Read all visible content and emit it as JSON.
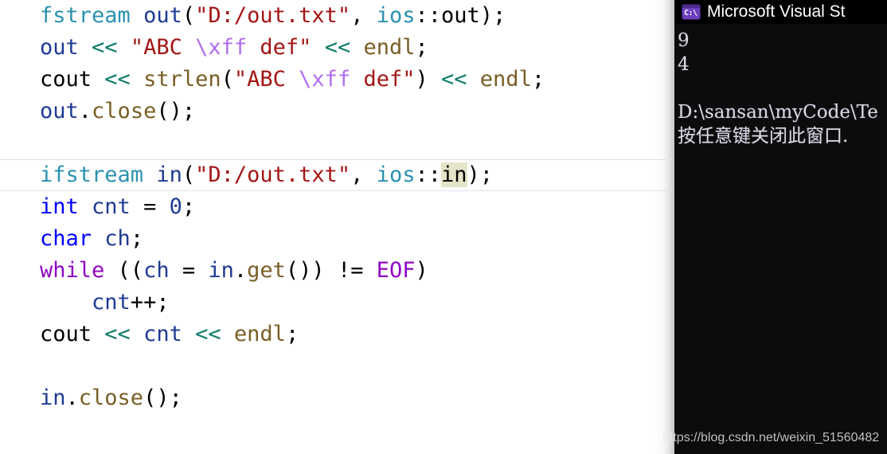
{
  "editor": {
    "name": "code-editor",
    "language": "cpp",
    "current_line_index": 5,
    "highlighted_reference": "in",
    "lines": [
      {
        "id": "line-1",
        "text": "fstream out(\"D:/out.txt\", ios::out);"
      },
      {
        "id": "line-2",
        "text": "out << \"ABC \\xff def\" << endl;"
      },
      {
        "id": "line-3",
        "text": "cout << strlen(\"ABC \\xff def\") << endl;"
      },
      {
        "id": "line-4",
        "text": "out.close();"
      },
      {
        "id": "line-5",
        "text": ""
      },
      {
        "id": "line-6",
        "text": "ifstream in(\"D:/out.txt\", ios::in);"
      },
      {
        "id": "line-7",
        "text": "int cnt = 0;"
      },
      {
        "id": "line-8",
        "text": "char ch;"
      },
      {
        "id": "line-9",
        "text": "while ((ch = in.get()) != EOF)"
      },
      {
        "id": "line-10",
        "text": "    cnt++;"
      },
      {
        "id": "line-11",
        "text": "cout << cnt << endl;"
      },
      {
        "id": "line-12",
        "text": ""
      },
      {
        "id": "line-13",
        "text": "in.close();"
      }
    ],
    "tokens": {
      "line1": [
        "fstream",
        "out",
        "(",
        "\"D:/out.txt\"",
        ",",
        "ios",
        "::",
        "out",
        ")",
        ";"
      ],
      "line2": [
        "out",
        "<<",
        "\"ABC ",
        "\\xff",
        " def\"",
        "<<",
        "endl",
        ";"
      ],
      "line3": [
        "cout",
        "<<",
        "strlen",
        "(",
        "\"ABC ",
        "\\xff",
        " def\"",
        ")",
        "<<",
        "endl",
        ";"
      ],
      "line4": [
        "out",
        ".",
        "close",
        "(",
        ")",
        ";"
      ],
      "line6": [
        "ifstream",
        "in",
        "(",
        "\"D:/out.txt\"",
        ",",
        "ios",
        "::",
        "in",
        ")",
        ";"
      ],
      "line7": [
        "int",
        "cnt",
        "=",
        "0",
        ";"
      ],
      "line8": [
        "char",
        "ch",
        ";"
      ],
      "line9": [
        "while",
        "(",
        "(",
        "ch",
        "=",
        "in",
        ".",
        "get",
        "(",
        ")",
        ")",
        "!=",
        "EOF",
        ")"
      ],
      "line10": [
        "cnt",
        "++",
        ";"
      ],
      "line11": [
        "cout",
        "<<",
        "cnt",
        "<<",
        "endl",
        ";"
      ],
      "line13": [
        "in",
        ".",
        "close",
        "(",
        ")",
        ";"
      ]
    }
  },
  "code_text": {
    "l1_type": "fstream",
    "l1_sp1": " ",
    "l1_var": "out",
    "l1_paren_open": "(",
    "l1_str": "\"D:/out.txt\"",
    "l1_comma": ", ",
    "l1_ios": "ios",
    "l1_scope": "::out",
    "l1_tail": ");",
    "l2_var": "out",
    "l2_sp1": " ",
    "l2_op1": "<<",
    "l2_sp2": " ",
    "l2_str_a": "\"ABC ",
    "l2_esc": "\\xff",
    "l2_str_b": " def\"",
    "l2_sp3": " ",
    "l2_op2": "<<",
    "l2_sp4": " ",
    "l2_endl": "endl",
    "l2_semi": ";",
    "l3_cout": "cout",
    "l3_sp1": " ",
    "l3_op1": "<<",
    "l3_sp2": " ",
    "l3_fn": "strlen",
    "l3_paren_open": "(",
    "l3_str_a": "\"ABC ",
    "l3_esc": "\\xff",
    "l3_str_b": " def\"",
    "l3_paren_close": ")",
    "l3_sp3": " ",
    "l3_op2": "<<",
    "l3_sp4": " ",
    "l3_endl": "endl",
    "l3_semi": ";",
    "l4_var": "out",
    "l4_dot": ".",
    "l4_fn": "close",
    "l4_tail": "();",
    "l6_type": "ifstream",
    "l6_sp1": " ",
    "l6_var": "in",
    "l6_paren_open": "(",
    "l6_str": "\"D:/out.txt\"",
    "l6_comma": ", ",
    "l6_ios": "ios",
    "l6_scope": "::",
    "l6_hl": "in",
    "l6_tail": ");",
    "l7_kw": "int",
    "l7_sp1": " ",
    "l7_var": "cnt",
    "l7_eq": " = ",
    "l7_num": "0",
    "l7_semi": ";",
    "l8_kw": "char",
    "l8_sp1": " ",
    "l8_var": "ch",
    "l8_semi": ";",
    "l9_kw": "while",
    "l9_sp1": " ",
    "l9_p1": "((",
    "l9_ch": "ch",
    "l9_eq": " = ",
    "l9_in": "in",
    "l9_dot": ".",
    "l9_get": "get",
    "l9_p2": "())",
    "l9_sp2": " ",
    "l9_neq": "!=",
    "l9_sp3": " ",
    "l9_eof": "EOF",
    "l9_p3": ")",
    "l10_indent": "    ",
    "l10_var": "cnt",
    "l10_tail": "++;",
    "l11_cout": "cout",
    "l11_sp1": " ",
    "l11_op1": "<<",
    "l11_sp2": " ",
    "l11_var": "cnt",
    "l11_sp3": " ",
    "l11_op2": "<<",
    "l11_sp4": " ",
    "l11_endl": "endl",
    "l11_semi": ";",
    "l13_var": "in",
    "l13_dot": ".",
    "l13_fn": "close",
    "l13_tail": "();"
  },
  "console": {
    "name": "visual-studio-debug-console",
    "title": "Microsoft Visual St",
    "icon": "cmd-console-icon",
    "icon_glyph": "C:\\",
    "background": "#0c0c0c",
    "text_color": "#d8d8dc",
    "lines": [
      {
        "id": "console-line-1",
        "text": "9"
      },
      {
        "id": "console-line-2",
        "text": "4"
      },
      {
        "id": "console-line-3",
        "text": ""
      },
      {
        "id": "console-line-4",
        "text": "D:\\sansan\\myCode\\Te"
      },
      {
        "id": "console-line-5",
        "text": "按任意键关闭此窗口."
      }
    ]
  },
  "watermark": {
    "text": "https://blog.csdn.net/weixin_51560482"
  },
  "colors": {
    "type": "#2b91af",
    "keyword": "#0000ff",
    "control_keyword": "#8f08c4",
    "identifier": "#1f3a93",
    "string": "#a31515",
    "escape": "#b06ef0",
    "function": "#795e26",
    "stream_operator": "#0e7c6b",
    "plain": "#000000",
    "reference_highlight": "#e4e4c8",
    "current_line_border": "#e0e0ea",
    "console_bg": "#0c0c0c",
    "console_fg": "#d8d8dc"
  }
}
